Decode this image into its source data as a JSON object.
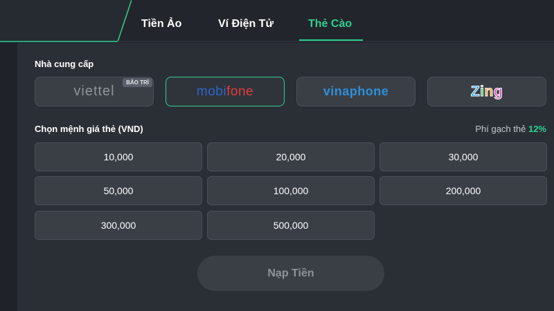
{
  "tabs": [
    {
      "label": "Tiền Ảo",
      "active": false
    },
    {
      "label": "Ví Điện Tử",
      "active": false
    },
    {
      "label": "Thẻ Cào",
      "active": true
    }
  ],
  "provider_section": {
    "label": "Nhà cung cấp",
    "providers": [
      {
        "name": "viettel",
        "badge": "BẢO TRÌ",
        "selected": false
      },
      {
        "name": "mobifone",
        "logo_parts": [
          "mobi",
          "fone"
        ],
        "selected": true
      },
      {
        "name": "vinaphone",
        "selected": false
      },
      {
        "name": "Zing",
        "letters": [
          "Z",
          "i",
          "n",
          "g"
        ],
        "selected": false
      }
    ]
  },
  "amount_section": {
    "label": "Chọn mệnh giá thẻ (VND)",
    "fee_label": "Phí gạch thẻ",
    "fee_value": "12%",
    "amounts": [
      "10,000",
      "20,000",
      "30,000",
      "50,000",
      "100,000",
      "200,000",
      "300,000",
      "500,000"
    ]
  },
  "submit_label": "Nạp Tiền",
  "colors": {
    "accent": "#2fd08f",
    "background": "#1f2329",
    "panel": "#2a2f36",
    "button": "#3a3f46"
  }
}
